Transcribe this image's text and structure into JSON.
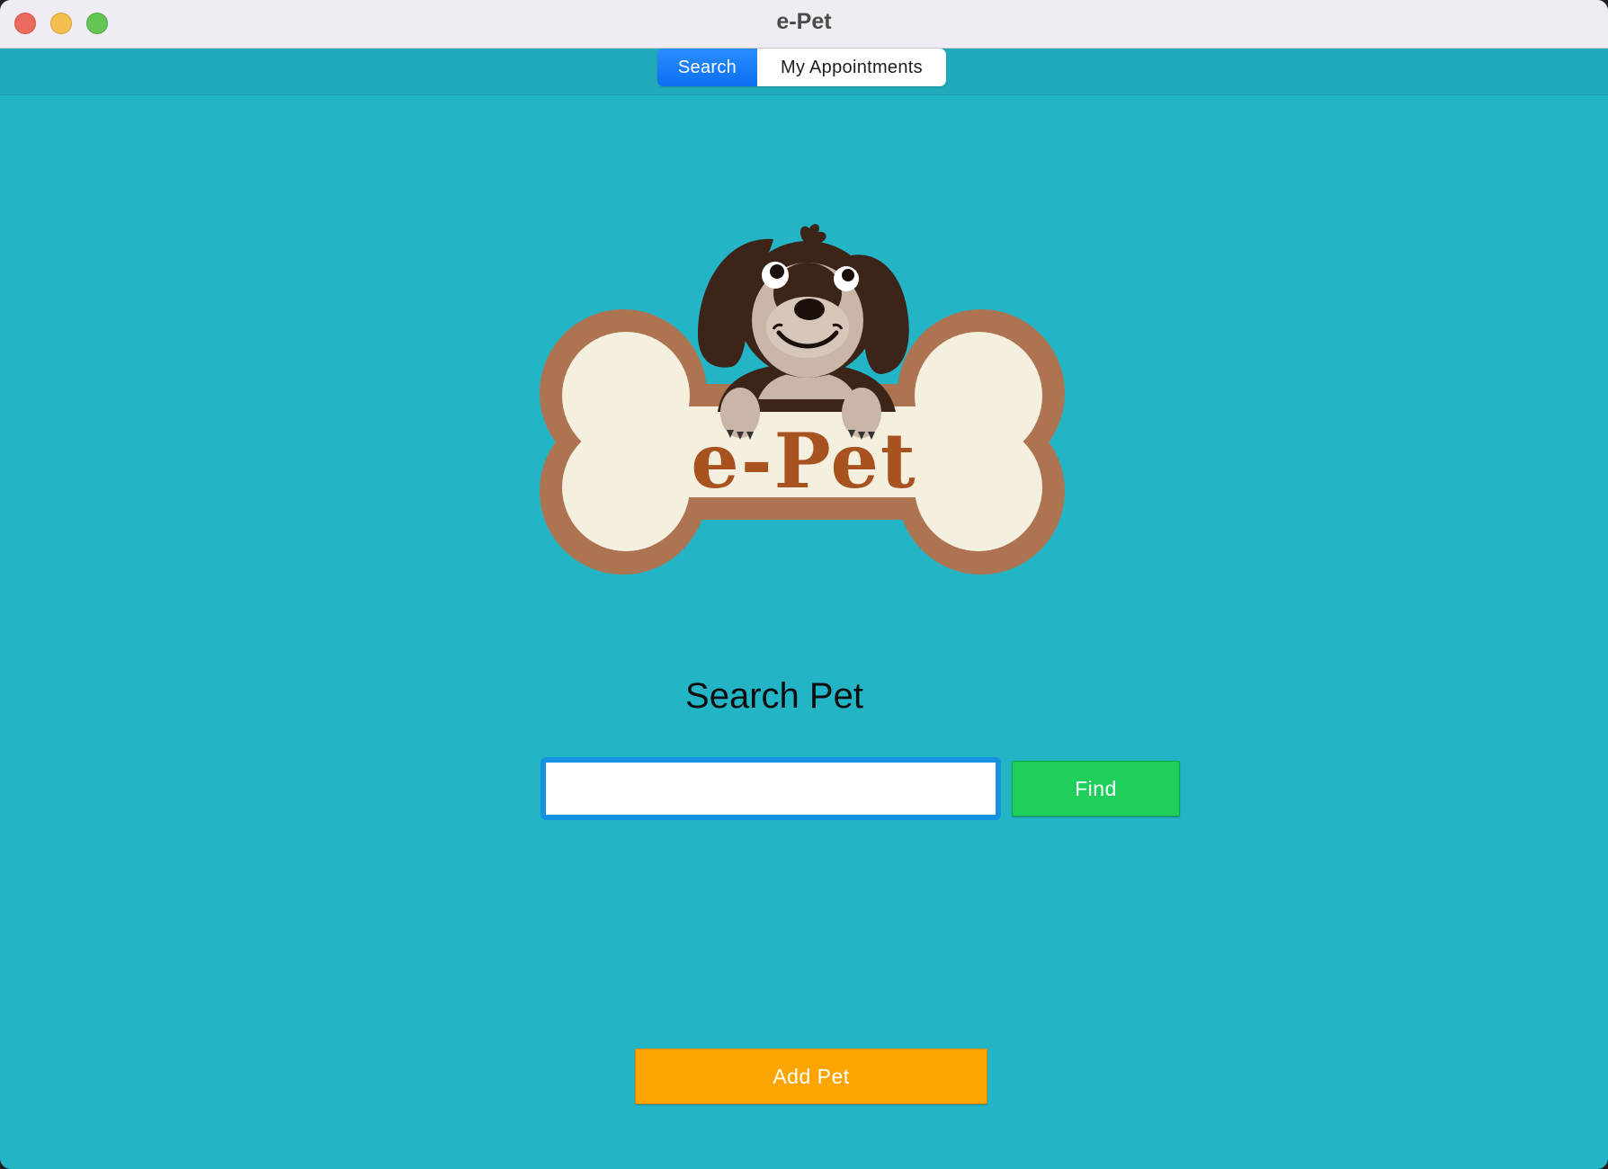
{
  "window": {
    "title": "e-Pet"
  },
  "tabs": [
    {
      "label": "Search",
      "active": true
    },
    {
      "label": "My Appointments",
      "active": false
    }
  ],
  "logo": {
    "text": "e-Pet",
    "icon": "dog-on-bone-logo"
  },
  "search": {
    "title": "Search Pet",
    "value": "",
    "placeholder": "",
    "find_label": "Find"
  },
  "actions": {
    "add_pet_label": "Add Pet"
  },
  "colors": {
    "background": "#23b5c6",
    "tab_active": "#0a6ff2",
    "find_button": "#1ed05a",
    "add_button": "#fca501",
    "input_border": "#1693e0"
  }
}
